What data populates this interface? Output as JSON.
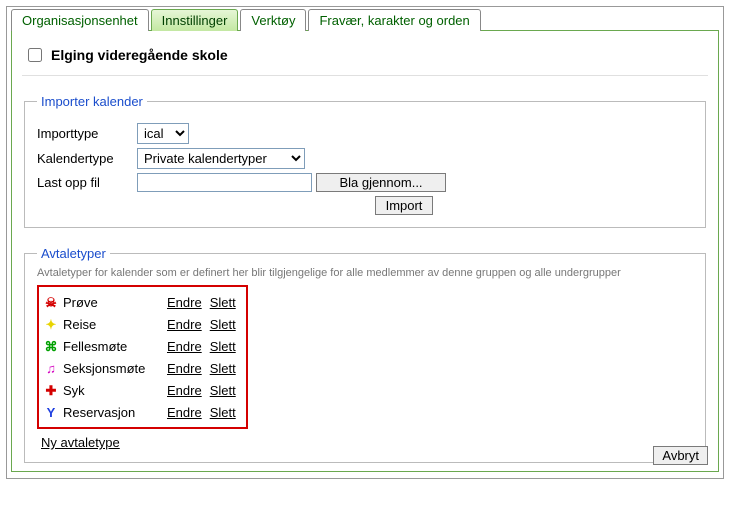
{
  "tabs": {
    "org": "Organisasjonsenhet",
    "settings": "Innstillinger",
    "tools": "Verktøy",
    "absence": "Fravær, karakter og orden"
  },
  "header": {
    "title": "Elging videregående skole"
  },
  "import": {
    "legend": "Importer kalender",
    "importtype_label": "Importtype",
    "importtype_value": "ical",
    "kalendertype_label": "Kalendertype",
    "kalendertype_value": "Private kalendertyper",
    "file_label": "Last opp fil",
    "browse_btn": "Bla gjennom...",
    "import_btn": "Import"
  },
  "avtale": {
    "legend": "Avtaletyper",
    "hint": "Avtaletyper for kalender som er definert her blir tilgjengelige for alle medlemmer av denne gruppen og alle undergrupper",
    "endre": "Endre",
    "slett": "Slett",
    "ny": "Ny avtaletype",
    "items": [
      {
        "name": "Prøve",
        "icon": "☠",
        "color": "#d40000"
      },
      {
        "name": "Reise",
        "icon": "✦",
        "color": "#e8d400"
      },
      {
        "name": "Fellesmøte",
        "icon": "⌘",
        "color": "#00a000"
      },
      {
        "name": "Seksjonsmøte",
        "icon": "♫",
        "color": "#d400c0"
      },
      {
        "name": "Syk",
        "icon": "✚",
        "color": "#d40000"
      },
      {
        "name": "Reservasjon",
        "icon": "Y",
        "color": "#2040e0"
      }
    ]
  },
  "footer": {
    "avbryt": "Avbryt"
  }
}
